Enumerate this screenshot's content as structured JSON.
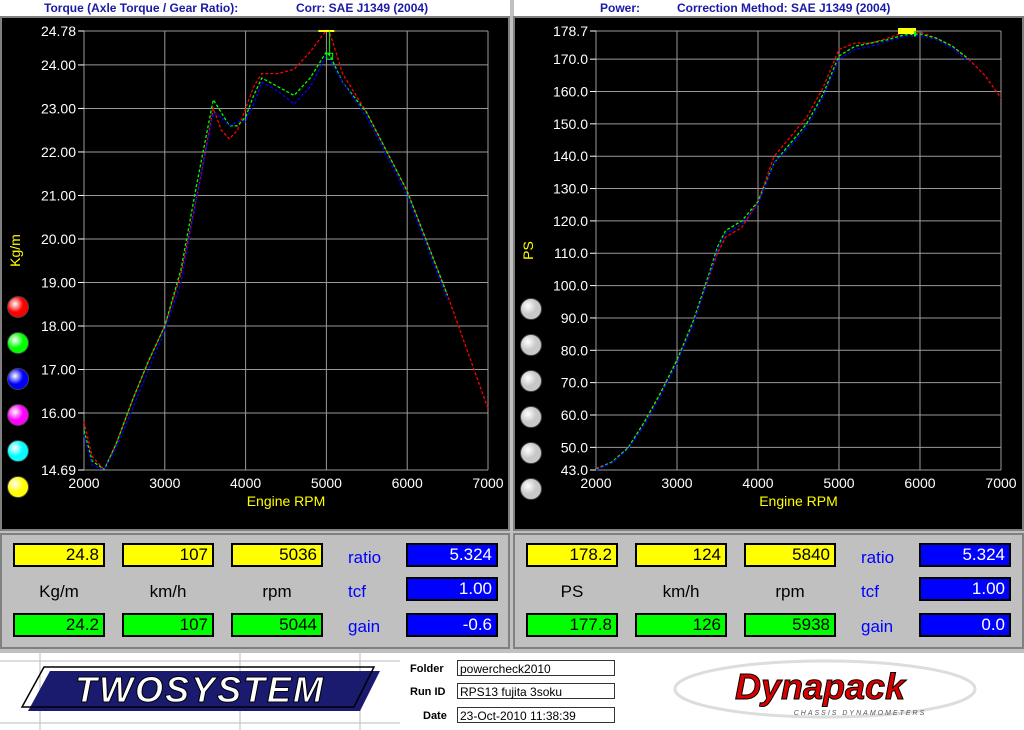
{
  "header": {
    "left_title": "Torque (Axle Torque / Gear Ratio):",
    "left_corr": "Corr: SAE J1349 (2004)",
    "right_title": "Power:",
    "right_corr": "Correction Method: SAE J1349 (2004)"
  },
  "legend_colors": {
    "left": [
      "#ff0000",
      "#00ff00",
      "#0000ff",
      "#ff00ff",
      "#00ffff",
      "#ffff00"
    ],
    "right": [
      "#c8c8c8",
      "#c8c8c8",
      "#c8c8c8",
      "#c8c8c8",
      "#c8c8c8",
      "#c8c8c8"
    ]
  },
  "chart_data": [
    {
      "type": "line",
      "xlabel": "Engine RPM",
      "ylabel": "Kg/m",
      "xlim": [
        2000,
        7000
      ],
      "ylim": [
        14.69,
        24.78
      ],
      "x_ticks": [
        "2000",
        "3000",
        "4000",
        "5000",
        "6000",
        "7000"
      ],
      "y_ticks": [
        "24.78",
        "24.00",
        "23.00",
        "22.00",
        "21.00",
        "20.00",
        "19.00",
        "18.00",
        "17.00",
        "16.00",
        "14.69"
      ],
      "series": [
        {
          "color": "#ff0000",
          "x": [
            2000,
            2100,
            2250,
            2400,
            2600,
            2800,
            3000,
            3200,
            3400,
            3600,
            3700,
            3800,
            3900,
            4000,
            4100,
            4200,
            4400,
            4600,
            4800,
            5000,
            5050,
            5200,
            5500,
            6000,
            6500,
            7000
          ],
          "y": [
            15.8,
            15.0,
            14.7,
            15.3,
            16.3,
            17.2,
            18.0,
            19.2,
            21.0,
            23.0,
            22.5,
            22.3,
            22.5,
            23.0,
            23.5,
            23.8,
            23.8,
            23.9,
            24.3,
            24.8,
            24.7,
            23.8,
            22.9,
            21.1,
            18.7,
            16.1
          ]
        },
        {
          "color": "#00ff00",
          "x": [
            2000,
            2100,
            2250,
            2400,
            2600,
            2800,
            3000,
            3200,
            3400,
            3600,
            3700,
            3800,
            3900,
            4000,
            4100,
            4200,
            4400,
            4600,
            4800,
            5000,
            5050,
            5200,
            5500,
            6000,
            6500
          ],
          "y": [
            15.6,
            14.9,
            14.7,
            15.3,
            16.3,
            17.2,
            18.0,
            19.3,
            21.3,
            23.2,
            22.9,
            22.6,
            22.6,
            22.8,
            23.3,
            23.7,
            23.5,
            23.3,
            23.7,
            24.3,
            24.2,
            23.6,
            22.9,
            21.1,
            18.7
          ]
        },
        {
          "color": "#0000ff",
          "x": [
            2000,
            2100,
            2250,
            2400,
            2600,
            2800,
            3000,
            3200,
            3400,
            3600,
            3700,
            3800,
            3900,
            4000,
            4100,
            4200,
            4400,
            4600,
            4800,
            5000,
            5050,
            5200,
            5500,
            6000,
            6500
          ],
          "y": [
            15.5,
            14.8,
            14.7,
            15.2,
            16.1,
            17.0,
            17.9,
            19.0,
            21.0,
            22.9,
            22.8,
            22.6,
            22.7,
            22.7,
            23.1,
            23.6,
            23.4,
            23.1,
            23.5,
            24.2,
            24.1,
            23.6,
            22.8,
            21.0,
            18.6
          ]
        }
      ]
    },
    {
      "type": "line",
      "xlabel": "Engine RPM",
      "ylabel": "PS",
      "xlim": [
        2000,
        7000
      ],
      "ylim": [
        43.0,
        178.7
      ],
      "x_ticks": [
        "2000",
        "3000",
        "4000",
        "5000",
        "6000",
        "7000"
      ],
      "y_ticks": [
        "178.7",
        "170.0",
        "160.0",
        "150.0",
        "140.0",
        "130.0",
        "120.0",
        "110.0",
        "100.0",
        "90.0",
        "80.0",
        "70.0",
        "60.0",
        "50.0",
        "43.0"
      ],
      "series": [
        {
          "color": "#ff0000",
          "x": [
            2000,
            2200,
            2400,
            2600,
            2800,
            3000,
            3200,
            3400,
            3500,
            3600,
            3800,
            4000,
            4200,
            4400,
            4600,
            4800,
            5000,
            5200,
            5400,
            5600,
            5800,
            6000,
            6200,
            6400,
            6600,
            6800,
            7000
          ],
          "y": [
            43.5,
            45.5,
            50,
            58,
            67,
            77,
            89,
            103,
            110,
            115,
            118,
            126,
            140,
            146,
            152,
            161,
            173,
            175,
            175,
            176.5,
            178.2,
            178.4,
            176.5,
            174,
            170,
            165,
            158
          ]
        },
        {
          "color": "#00ff00",
          "x": [
            2000,
            2200,
            2400,
            2600,
            2800,
            3000,
            3200,
            3400,
            3500,
            3600,
            3800,
            4000,
            4200,
            4400,
            4600,
            4800,
            5000,
            5200,
            5400,
            5600,
            5800,
            6000,
            6200,
            6400,
            6600
          ],
          "y": [
            43.2,
            45.5,
            50,
            58,
            67,
            77,
            89,
            104,
            112,
            117,
            120,
            126,
            138,
            144,
            150,
            159,
            171,
            174,
            175,
            176,
            177.5,
            177.8,
            176.5,
            174,
            170
          ]
        },
        {
          "color": "#0000ff",
          "x": [
            2000,
            2200,
            2400,
            2600,
            2800,
            3000,
            3200,
            3400,
            3500,
            3600,
            3800,
            4000,
            4200,
            4400,
            4600,
            4800,
            5000,
            5200,
            5400,
            5600,
            5800,
            6000,
            6200,
            6400,
            6600
          ],
          "y": [
            43.0,
            45.2,
            49.5,
            57,
            66,
            76,
            88,
            103,
            111,
            116,
            119,
            125,
            138,
            143,
            149,
            158,
            170,
            173,
            174,
            175.5,
            177,
            177.3,
            176,
            173.5,
            169
          ]
        }
      ]
    }
  ],
  "readout_left": {
    "row1": [
      "24.8",
      "107",
      "5036"
    ],
    "units": [
      "Kg/m",
      "km/h",
      "rpm"
    ],
    "row2": [
      "24.2",
      "107",
      "5044"
    ],
    "ratio_label": "ratio",
    "ratio": "5.324",
    "tcf_label": "tcf",
    "tcf": "1.00",
    "gain_label": "gain",
    "gain": "-0.6"
  },
  "readout_right": {
    "row1": [
      "178.2",
      "124",
      "5840"
    ],
    "units": [
      "PS",
      "km/h",
      "rpm"
    ],
    "row2": [
      "177.8",
      "126",
      "5938"
    ],
    "ratio_label": "ratio",
    "ratio": "5.324",
    "tcf_label": "tcf",
    "tcf": "1.00",
    "gain_label": "gain",
    "gain": "0.0"
  },
  "footer": {
    "logo_text": "TWOSYSTEM",
    "folder_label": "Folder",
    "folder": "powercheck2010",
    "runid_label": "Run ID",
    "runid": "RPS13 fujita 3soku",
    "date_label": "Date",
    "date": "23-Oct-2010  11:38:39",
    "brand": "Dynapack",
    "brand_sub": "CHASSIS DYNAMOMETERS"
  }
}
